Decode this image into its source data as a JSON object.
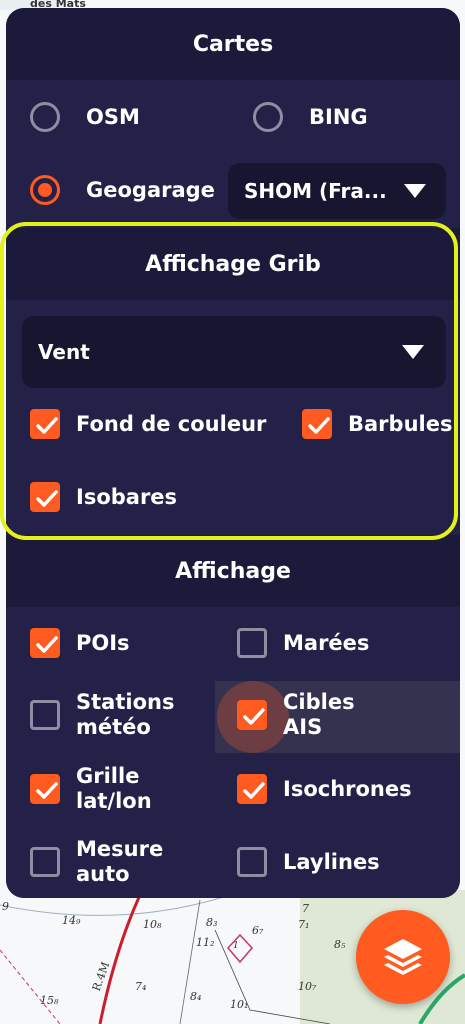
{
  "map": {
    "place_label": "des Mats",
    "soundings": [
      "9",
      "7",
      "14₉",
      "10₈",
      "8₃",
      "6₇",
      "7₁",
      "8₅",
      "11₂",
      "7₄",
      "15₈",
      "10₁",
      "8₄",
      "10₇",
      "R.4M",
      "1"
    ]
  },
  "cartes": {
    "title": "Cartes",
    "options": [
      {
        "label": "OSM",
        "checked": false
      },
      {
        "label": "BING",
        "checked": false
      },
      {
        "label": "Geogarage",
        "checked": true
      }
    ],
    "chart_select": "SHOM (Fra..."
  },
  "grib": {
    "title": "Affichage Grib",
    "layer_select": "Vent",
    "options": [
      {
        "label": "Fond de couleur",
        "checked": true
      },
      {
        "label": "Barbules",
        "checked": true
      },
      {
        "label": "Isobares",
        "checked": true
      }
    ]
  },
  "affichage": {
    "title": "Affichage",
    "options": [
      {
        "label": "POIs",
        "checked": true
      },
      {
        "label": "Marées",
        "checked": false
      },
      {
        "label": "Stations\nmétéo",
        "checked": false
      },
      {
        "label": "Cibles\nAIS",
        "checked": true
      },
      {
        "label": "Grille\nlat/lon",
        "checked": true
      },
      {
        "label": "Isochrones",
        "checked": true
      },
      {
        "label": "Mesure\nauto",
        "checked": false
      },
      {
        "label": "Laylines",
        "checked": false
      }
    ]
  },
  "colors": {
    "accent": "#ff5a1f",
    "panel": "#1c1a3b",
    "highlight": "#e3f21a"
  },
  "fab_icon": "layers-icon"
}
